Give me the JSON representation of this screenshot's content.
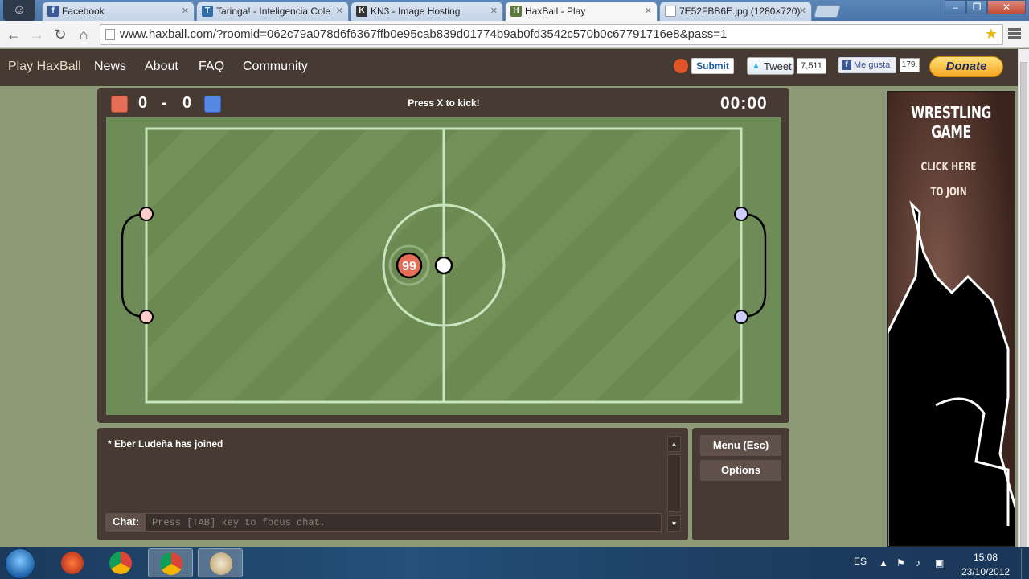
{
  "browser": {
    "tabs": [
      {
        "label": "Facebook",
        "icon": "facebook-icon",
        "icon_text": "f",
        "color": "#3b5998"
      },
      {
        "label": "Taringa! - Inteligencia Cole",
        "icon": "taringa-icon",
        "icon_text": "T",
        "color": "#2f6ca8"
      },
      {
        "label": "KN3 - Image Hosting",
        "icon": "kn3-icon",
        "icon_text": "K",
        "color": "#333333"
      },
      {
        "label": "HaxBall - Play",
        "icon": "haxball-icon",
        "icon_text": "H",
        "color": "#5b7a3c",
        "active": true
      },
      {
        "label": "7E52FBB6E.jpg (1280×720)",
        "icon": "page-icon",
        "icon_text": "",
        "color": "#ffffff"
      }
    ],
    "url": "www.haxball.com/?roomid=062c79a078d6f6367ffb0e95cab839d01774b9ab0fd3542c570b0c67791716e8&pass=1"
  },
  "site_nav": {
    "brand": "Play HaxBall",
    "links": [
      "News",
      "About",
      "FAQ",
      "Community"
    ]
  },
  "social": {
    "submit_label": "Submit",
    "tweet_label": "Tweet",
    "tweet_count": "7,511",
    "like_label": "Me gusta",
    "like_count": "179.",
    "donate_label": "Donate"
  },
  "game": {
    "red_score": "0",
    "score_separator": "-",
    "blue_score": "0",
    "message": "Press X to kick!",
    "timer": "00:00",
    "player_number": "99",
    "colors": {
      "red": "#e56e56",
      "blue": "#5689e5",
      "field": "#718c5a",
      "panel": "#463a32"
    }
  },
  "chat": {
    "log": [
      "* Eber Ludeña has joined"
    ],
    "label": "Chat:",
    "placeholder": "Press [TAB] key to focus chat."
  },
  "menu": {
    "menu_button": "Menu (Esc)",
    "options_button": "Options"
  },
  "ad": {
    "title": "WRESTLING GAME",
    "line1": "CLICK HERE",
    "line2": "TO JOIN"
  },
  "taskbar": {
    "language": "ES",
    "time": "15:08",
    "date": "23/10/2012"
  }
}
